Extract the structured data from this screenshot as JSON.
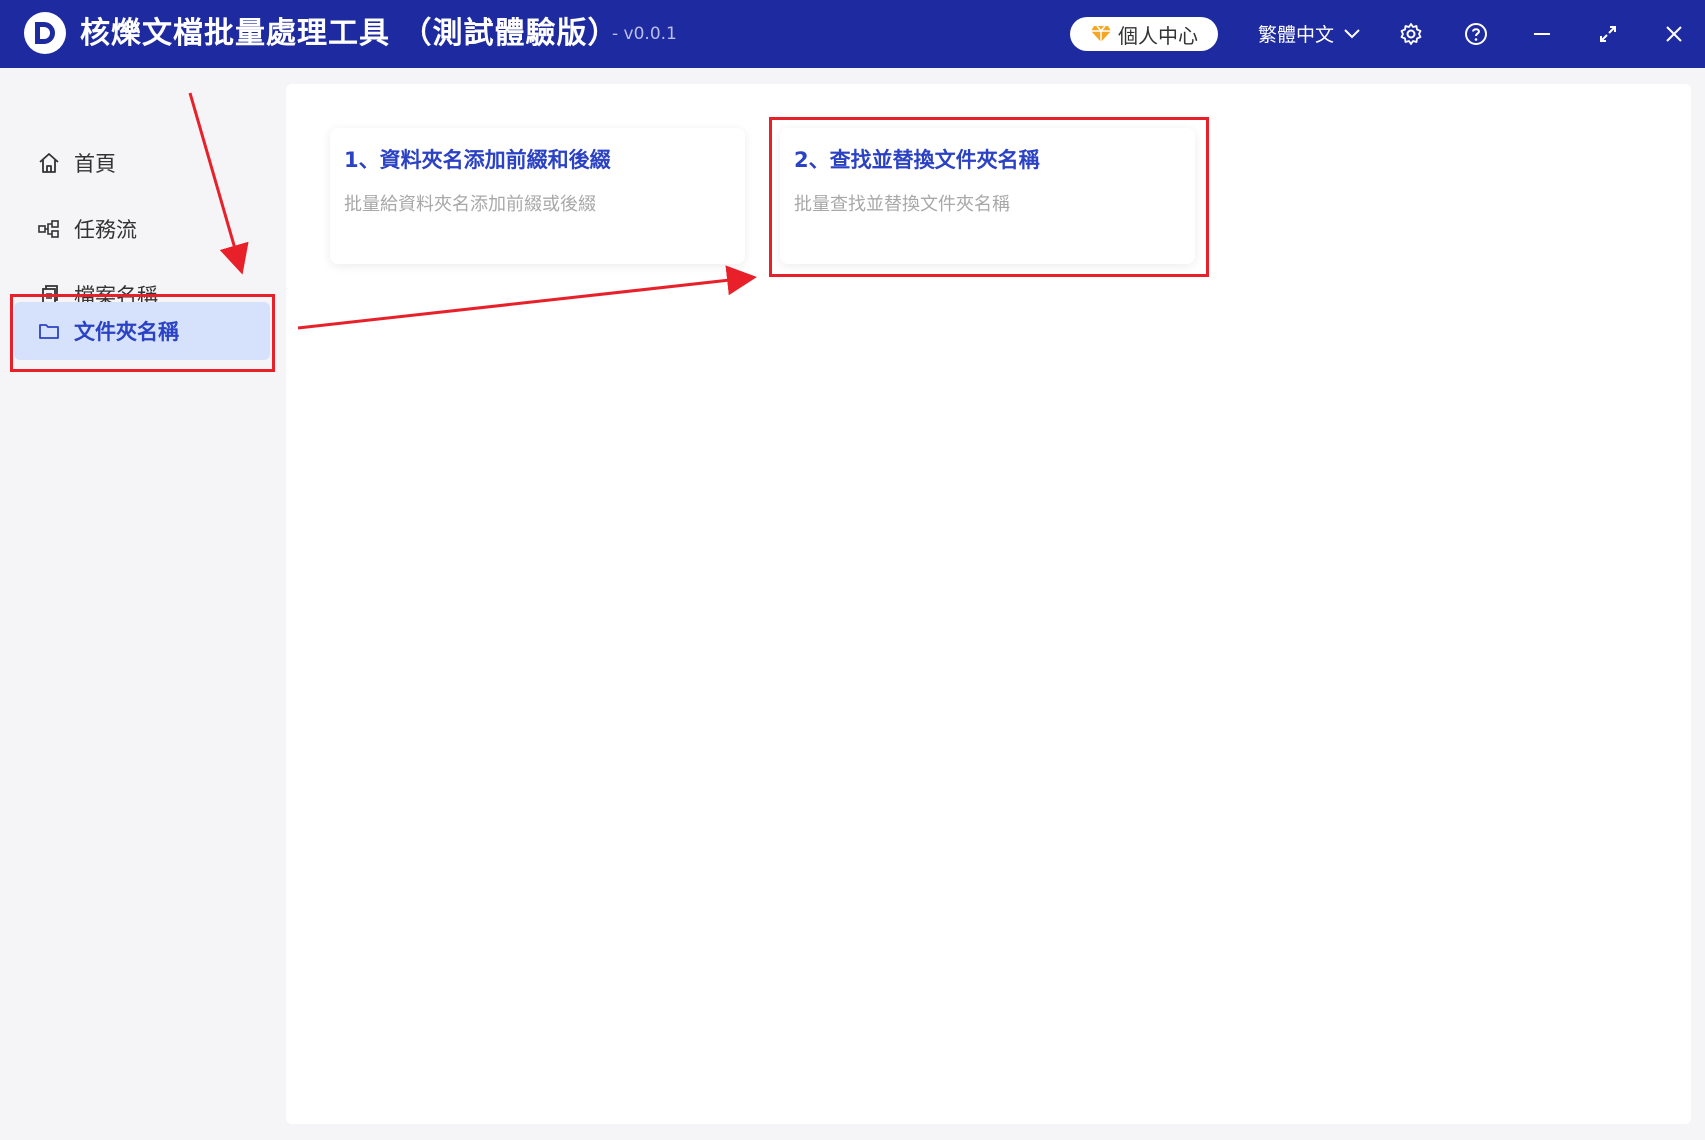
{
  "window": {
    "title": "核爍文檔批量處理工具 （測試體驗版）",
    "version": "- v0.0.1",
    "vip_label": "個人中心",
    "language": "繁體中文",
    "icons": [
      "settings-gear-icon",
      "help-icon",
      "minimize-icon",
      "maximize-icon",
      "close-icon"
    ]
  },
  "sidebar": {
    "items": [
      {
        "label": "首頁",
        "icon": "home-icon"
      },
      {
        "label": "任務流",
        "icon": "workflow-icon"
      },
      {
        "label": "檔案名稱",
        "icon": "file-copy-icon"
      },
      {
        "label": "文件夾名稱",
        "icon": "folder-icon",
        "active": true
      }
    ]
  },
  "main": {
    "cards": [
      {
        "title": "1、資料夾名添加前綴和後綴",
        "desc": "批量給資料夾名添加前綴或後綴"
      },
      {
        "title": "2、查找並替換文件夾名稱",
        "desc": "批量查找並替換文件夾名稱"
      }
    ]
  },
  "colors": {
    "titlebar": "#1e2aa0",
    "accent": "#2b42c4",
    "active_bg": "#d6e2fb",
    "annotation": "#e8202a"
  }
}
